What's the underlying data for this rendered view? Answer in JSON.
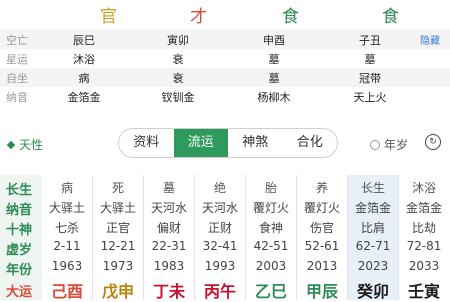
{
  "gods": [
    "官",
    "才",
    "食",
    "食"
  ],
  "pillars": {
    "rows": [
      {
        "label": "空亡",
        "cells": [
          "辰巳",
          "寅卯",
          "申酉",
          "子丑"
        ],
        "link": "隐藏"
      },
      {
        "label": "星运",
        "cells": [
          "沐浴",
          "衰",
          "墓",
          "墓"
        ]
      },
      {
        "label": "自坐",
        "cells": [
          "病",
          "衰",
          "墓",
          "冠带"
        ]
      },
      {
        "label": "纳音",
        "cells": [
          "金箔金",
          "钗钏金",
          "杨柳木",
          "天上火"
        ]
      }
    ]
  },
  "toolbar": {
    "tianxing": "天性",
    "tabs": [
      "资料",
      "流运",
      "神煞",
      "合化"
    ],
    "active_tab": "流运",
    "nianyu": "年岁",
    "swap_icon": "refresh-icon"
  },
  "grid": {
    "row_labels": [
      "长生",
      "纳音",
      "十神",
      "虚岁",
      "年份",
      "大运"
    ],
    "columns": [
      {
        "top": "病",
        "nayin": "大驿土",
        "shishen": "七杀",
        "age": "2-11",
        "year": "1963",
        "stem": "己酉"
      },
      {
        "top": "死",
        "nayin": "大驿土",
        "shishen": "正官",
        "age": "12-21",
        "year": "1973",
        "stem": "戊申"
      },
      {
        "top": "墓",
        "nayin": "天河水",
        "shishen": "偏财",
        "age": "22-31",
        "year": "1983",
        "stem": "丁未"
      },
      {
        "top": "绝",
        "nayin": "天河水",
        "shishen": "正财",
        "age": "32-41",
        "year": "1993",
        "stem": "丙午"
      },
      {
        "top": "胎",
        "nayin": "覆灯火",
        "shishen": "食神",
        "age": "42-51",
        "year": "2003",
        "stem": "乙巳"
      },
      {
        "top": "养",
        "nayin": "覆灯火",
        "shishen": "伤官",
        "age": "52-61",
        "year": "2013",
        "stem": "甲辰"
      },
      {
        "top": "长生",
        "nayin": "金箔金",
        "shishen": "比肩",
        "age": "62-71",
        "year": "2023",
        "stem": "癸卯"
      },
      {
        "top": "沐浴",
        "nayin": "金箔金",
        "shishen": "比劫",
        "age": "72-81",
        "year": "2033",
        "stem": "壬寅"
      }
    ],
    "highlight_index": 6
  },
  "colors": {
    "accent": "#2e9a5c",
    "god_colors": [
      "#c9a227",
      "#d94a3a",
      "#2e8b57",
      "#2e8b57"
    ],
    "stem_colors": [
      "#d94a3a",
      "#b8860b",
      "#c8102e",
      "#c8102e",
      "#2e8b57",
      "#2e8b57",
      "#1a1a1a",
      "#1a1a1a"
    ]
  }
}
